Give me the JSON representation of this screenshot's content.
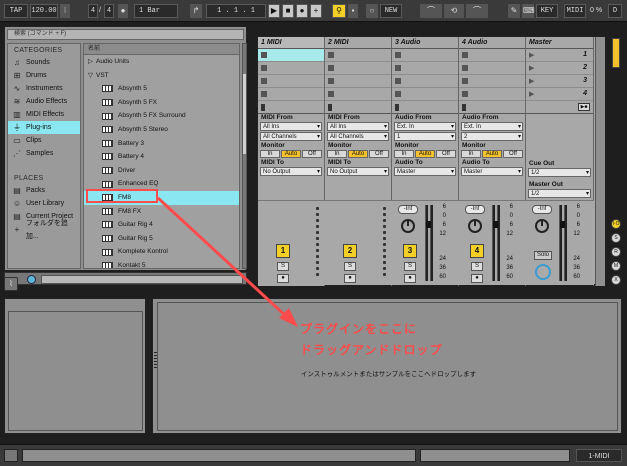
{
  "transport": {
    "tap": "TAP",
    "tempo": "120.00",
    "meter_num": "4",
    "meter_sep": "/",
    "meter_den": "4",
    "quantize": "1 Bar",
    "position": "1 .  1 .  1",
    "new_button": "NEW",
    "key_button": "KEY",
    "midi_button": "MIDI",
    "cpu": "0 %",
    "disk": "D"
  },
  "browser": {
    "search_placeholder": "検索 (コマンド + F)",
    "categories_title": "CATEGORIES",
    "categories": [
      {
        "label": "Sounds",
        "icon": "note-icon"
      },
      {
        "label": "Drums",
        "icon": "grid-icon"
      },
      {
        "label": "Instruments",
        "icon": "wave-icon"
      },
      {
        "label": "Audio Effects",
        "icon": "waveform-icon"
      },
      {
        "label": "MIDI Effects",
        "icon": "bars-icon"
      },
      {
        "label": "Plug-ins",
        "icon": "plug-icon"
      },
      {
        "label": "Clips",
        "icon": "clip-icon"
      },
      {
        "label": "Samples",
        "icon": "sample-icon"
      }
    ],
    "places_title": "PLACES",
    "places": [
      {
        "label": "Packs"
      },
      {
        "label": "User Library"
      },
      {
        "label": "Current Project"
      },
      {
        "label": "フォルダを追加..."
      }
    ],
    "name_header": "名前",
    "files": [
      {
        "label": "Audio Units",
        "type": "folder",
        "arrow": "▷"
      },
      {
        "label": "VST",
        "type": "folder",
        "arrow": "▽"
      },
      {
        "label": "Absynth 5",
        "type": "plugin"
      },
      {
        "label": "Absynth 5 FX",
        "type": "plugin"
      },
      {
        "label": "Absynth 5 FX Surround",
        "type": "plugin"
      },
      {
        "label": "Absynth 5 Stereo",
        "type": "plugin"
      },
      {
        "label": "Battery 3",
        "type": "plugin"
      },
      {
        "label": "Battery 4",
        "type": "plugin"
      },
      {
        "label": "Driver",
        "type": "plugin"
      },
      {
        "label": "Enhanced EQ",
        "type": "plugin"
      },
      {
        "label": "FM8",
        "type": "plugin"
      },
      {
        "label": "FM8 FX",
        "type": "plugin"
      },
      {
        "label": "Guitar Rig 4",
        "type": "plugin"
      },
      {
        "label": "Guitar Rig 5",
        "type": "plugin"
      },
      {
        "label": "Komplete Kontrol",
        "type": "plugin"
      },
      {
        "label": "Kontakt 5",
        "type": "plugin"
      }
    ]
  },
  "session": {
    "tracks": [
      {
        "title": "1 MIDI",
        "num": "1",
        "from_label": "MIDI From",
        "from": "All Ins",
        "ch": "All Channels",
        "to_label": "MIDI To",
        "to": "No Output",
        "kind": "midi"
      },
      {
        "title": "2 MIDI",
        "num": "2",
        "from_label": "MIDI From",
        "from": "All Ins",
        "ch": "All Channels",
        "to_label": "MIDI To",
        "to": "No Output",
        "kind": "midi"
      },
      {
        "title": "3 Audio",
        "num": "3",
        "from_label": "Audio From",
        "from": "Ext. In",
        "ch": "1",
        "to_label": "Audio To",
        "to": "Master",
        "kind": "audio"
      },
      {
        "title": "4 Audio",
        "num": "4",
        "from_label": "Audio From",
        "from": "Ext. In",
        "ch": "2",
        "to_label": "Audio To",
        "to": "Master",
        "kind": "audio"
      }
    ],
    "master": {
      "title": "Master",
      "scenes": [
        "1",
        "2",
        "3",
        "4"
      ],
      "cue_out_label": "Cue Out",
      "cue_out": "1/2",
      "master_out_label": "Master Out",
      "master_out": "1/2",
      "solo": "Solo"
    },
    "monitor_label": "Monitor",
    "monitor": [
      "In",
      "Auto",
      "Off"
    ],
    "inf": "-Inf",
    "scale": [
      "6",
      "0",
      "6",
      "12",
      "24",
      "36",
      "60"
    ],
    "solo_btn": "S"
  },
  "detail": {
    "drop_hint": "インストゥルメントまたはサンプルをここへドロップします",
    "annotation_line1": "プラグインをここに",
    "annotation_line2": "ドラッグアンドドロップ"
  },
  "status": {
    "midi_label": "1-MIDI"
  },
  "colors": {
    "selection": "#8ae6f0",
    "accent": "#f3d028",
    "annotation": "#ff4b4b"
  }
}
